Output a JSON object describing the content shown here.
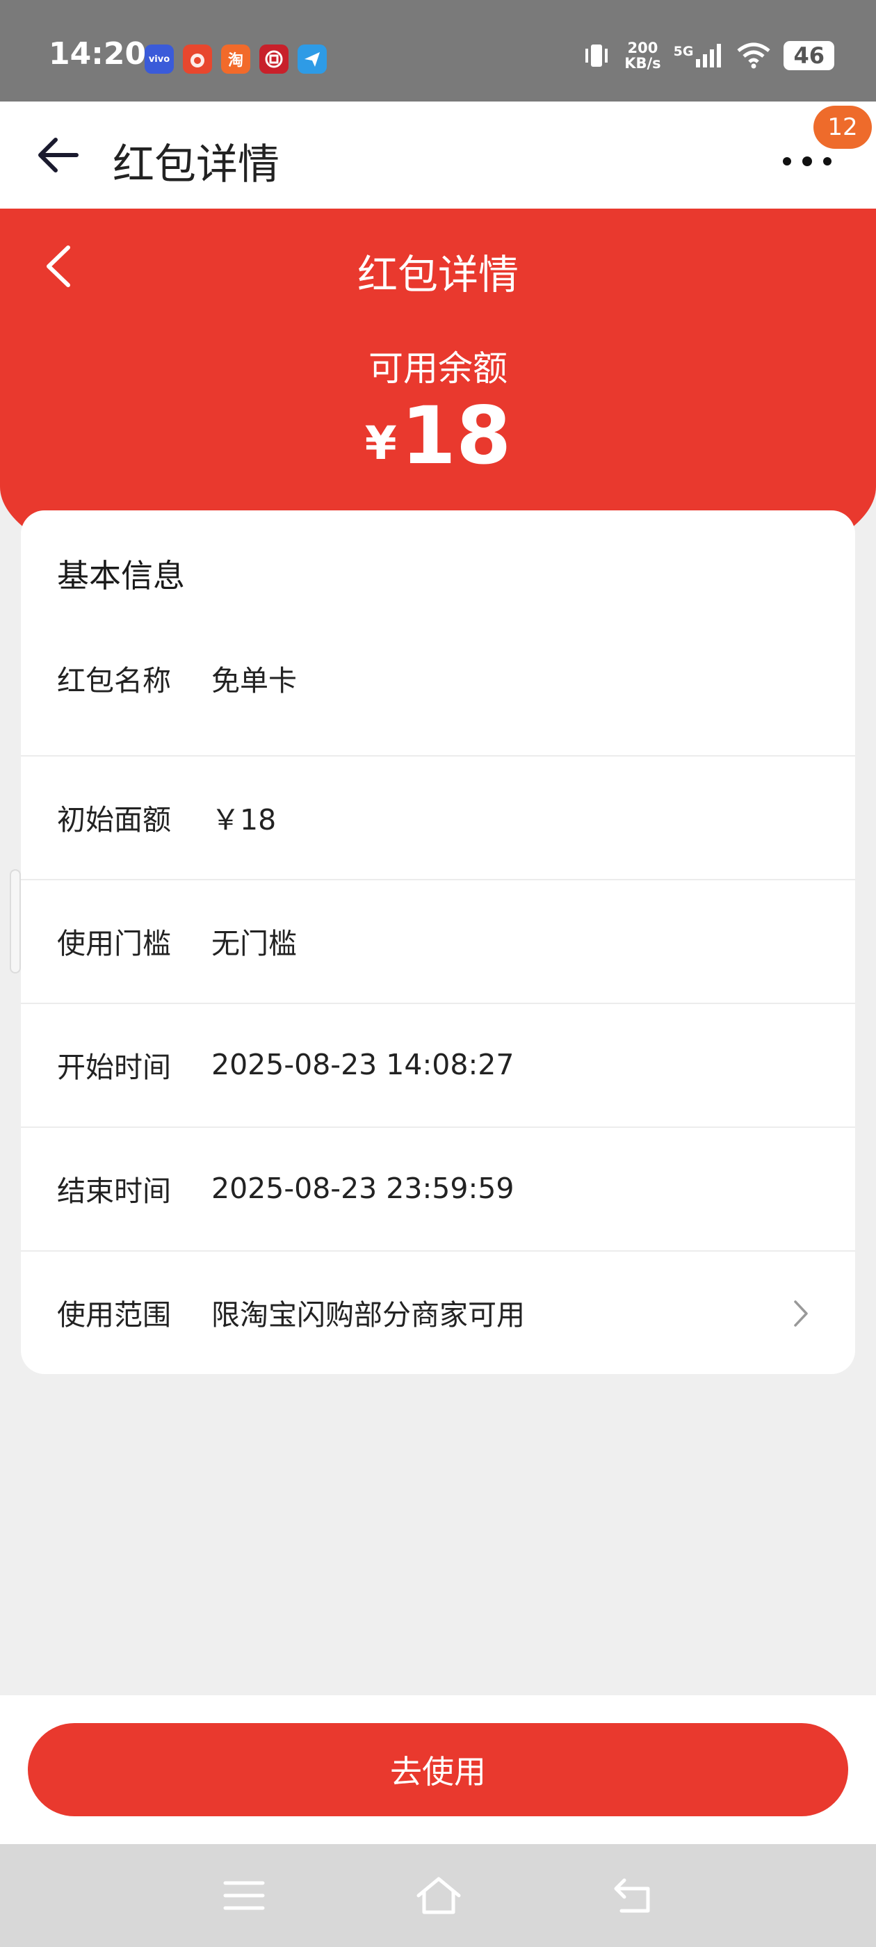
{
  "status_bar": {
    "time": "14:20",
    "apps": [
      {
        "name": "vivo-icon",
        "text": "vivo",
        "color": "#3a5bd9"
      },
      {
        "name": "app-orange-icon",
        "text": "",
        "color": "#e8472e"
      },
      {
        "name": "taobao-icon",
        "text": "淘",
        "color": "#f26a2a"
      },
      {
        "name": "bank-icon",
        "text": "",
        "color": "#c8202a"
      },
      {
        "name": "paper-plane-icon",
        "text": "",
        "color": "#2e9be6"
      }
    ],
    "speed_value": "200",
    "speed_unit": "KB/s",
    "network": "5G",
    "battery": "46"
  },
  "app_header": {
    "title": "红包详情",
    "notification_count": "12"
  },
  "hero": {
    "title": "红包详情",
    "balance_label": "可用余额",
    "currency": "¥",
    "balance": "18",
    "color": "#e9392e"
  },
  "card": {
    "title": "基本信息",
    "rows": [
      {
        "label": "红包名称",
        "value": "免单卡"
      },
      {
        "label": "初始面额",
        "value": "￥18"
      },
      {
        "label": "使用门槛",
        "value": "无门槛"
      },
      {
        "label": "开始时间",
        "value": "2025-08-23 14:08:27"
      },
      {
        "label": "结束时间",
        "value": "2025-08-23 23:59:59"
      },
      {
        "label": "使用范围",
        "value": "限淘宝闪购部分商家可用"
      }
    ]
  },
  "action": {
    "use_label": "去使用"
  }
}
